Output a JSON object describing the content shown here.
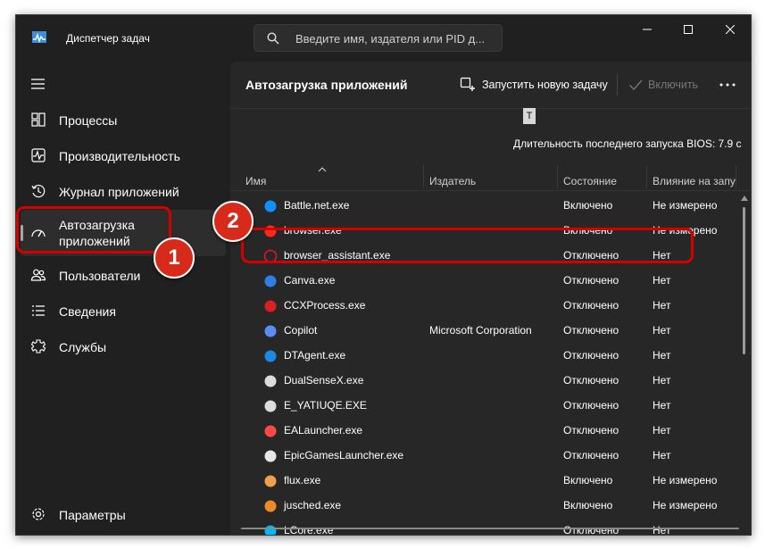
{
  "window": {
    "title": "Диспетчер задач",
    "search_placeholder": "Введите имя, издателя или PID д..."
  },
  "sidebar": {
    "items": [
      {
        "label": "Процессы",
        "icon": "processes-icon"
      },
      {
        "label": "Производительность",
        "icon": "performance-icon"
      },
      {
        "label": "Журнал приложений",
        "icon": "app-history-icon"
      },
      {
        "label": "Автозагрузка приложений",
        "icon": "startup-apps-icon",
        "active": true
      },
      {
        "label": "Пользователи",
        "icon": "users-icon"
      },
      {
        "label": "Сведения",
        "icon": "details-icon"
      },
      {
        "label": "Службы",
        "icon": "services-icon"
      }
    ],
    "settings_label": "Параметры"
  },
  "main": {
    "title": "Автозагрузка приложений",
    "run_task_label": "Запустить новую задачу",
    "enable_label": "Включить",
    "tooltip": "T",
    "bios_text": "Длительность последнего запуска BIOS: 7.9 с",
    "columns": [
      "Имя",
      "Издатель",
      "Состояние",
      "Влияние на запу"
    ],
    "rows": [
      {
        "name": "Battle.net.exe",
        "publisher": "",
        "status": "Включено",
        "impact": "Не измерено",
        "icon": "battlenet-icon",
        "color": "#148eff"
      },
      {
        "name": "browser.exe",
        "publisher": "",
        "status": "Включено",
        "impact": "Не измерено",
        "icon": "yandex-browser-icon",
        "color": "#ff2a1a"
      },
      {
        "name": "browser_assistant.exe",
        "publisher": "",
        "status": "Отключено",
        "impact": "Нет",
        "icon": "opera-icon",
        "color": "#e0112b"
      },
      {
        "name": "Canva.exe",
        "publisher": "",
        "status": "Отключено",
        "impact": "Нет",
        "icon": "canva-icon",
        "color": "#2f7ee8"
      },
      {
        "name": "CCXProcess.exe",
        "publisher": "",
        "status": "Отключено",
        "impact": "Нет",
        "icon": "adobe-cc-icon",
        "color": "#da1f26"
      },
      {
        "name": "Copilot",
        "publisher": "Microsoft Corporation",
        "status": "Отключено",
        "impact": "Нет",
        "icon": "copilot-icon",
        "color": "#5b8cf5"
      },
      {
        "name": "DTAgent.exe",
        "publisher": "",
        "status": "Отключено",
        "impact": "Нет",
        "icon": "daemon-tools-icon",
        "color": "#1e88e5"
      },
      {
        "name": "DualSenseX.exe",
        "publisher": "",
        "status": "Отключено",
        "impact": "Нет",
        "icon": "dualsensex-icon",
        "color": "#dcdcdc"
      },
      {
        "name": "E_YATIUQE.EXE",
        "publisher": "",
        "status": "Отключено",
        "impact": "Нет",
        "icon": "epson-icon",
        "color": "#dcdcdc"
      },
      {
        "name": "EALauncher.exe",
        "publisher": "",
        "status": "Отключено",
        "impact": "Нет",
        "icon": "ea-icon",
        "color": "#ff4747"
      },
      {
        "name": "EpicGamesLauncher.exe",
        "publisher": "",
        "status": "Отключено",
        "impact": "Нет",
        "icon": "epic-games-icon",
        "color": "#e8e8e8"
      },
      {
        "name": "flux.exe",
        "publisher": "",
        "status": "Включено",
        "impact": "Не измерено",
        "icon": "flux-icon",
        "color": "#f0a04b"
      },
      {
        "name": "jusched.exe",
        "publisher": "",
        "status": "Включено",
        "impact": "Не измерено",
        "icon": "java-icon",
        "color": "#f08a24"
      },
      {
        "name": "LCore.exe",
        "publisher": "",
        "status": "Отключено",
        "impact": "Нет",
        "icon": "logitech-icon",
        "color": "#00b8fc"
      }
    ]
  },
  "annotations": {
    "badge1": "1",
    "badge2": "2",
    "color": "#d60000"
  }
}
